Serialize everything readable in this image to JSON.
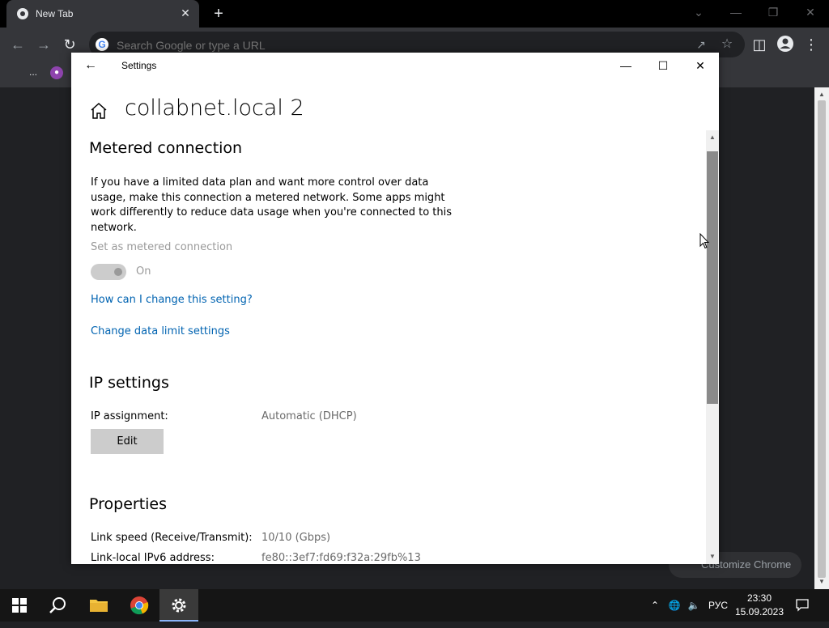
{
  "chrome": {
    "tab_title": "New Tab",
    "tab_close": "✕",
    "new_tab": "+",
    "window_controls": {
      "dropdown": "⌄",
      "minimize": "—",
      "restore": "❐",
      "close": "✕"
    },
    "omnibox_placeholder": "Search Google or type a URL",
    "omnibox_g": "G",
    "bookmarks_more": "...",
    "customize_label": "Customize Chrome"
  },
  "settings": {
    "window_title": "Settings",
    "page_title": "collabnet.local 2",
    "metered": {
      "heading": "Metered connection",
      "description": "If you have a limited data plan and want more control over data usage, make this connection a metered network. Some apps might work differently to reduce data usage when you're connected to this network.",
      "toggle_label": "Set as metered connection",
      "toggle_state": "On",
      "link_change": "How can I change this setting?",
      "link_data_limit": "Change data limit settings"
    },
    "ip": {
      "heading": "IP settings",
      "assignment_label": "IP assignment:",
      "assignment_value": "Automatic (DHCP)",
      "edit_label": "Edit"
    },
    "properties": {
      "heading": "Properties",
      "rows": [
        {
          "label": "Link speed (Receive/Transmit):",
          "value": "10/10 (Gbps)"
        },
        {
          "label": "Link-local IPv6 address:",
          "value": "fe80::3ef7:fd69:f32a:29fb%13"
        }
      ]
    }
  },
  "taskbar": {
    "lang": "РУС",
    "time": "23:30",
    "date": "15.09.2023"
  },
  "colors": {
    "link": "#0063b1",
    "accent": "#8ab4f8"
  }
}
